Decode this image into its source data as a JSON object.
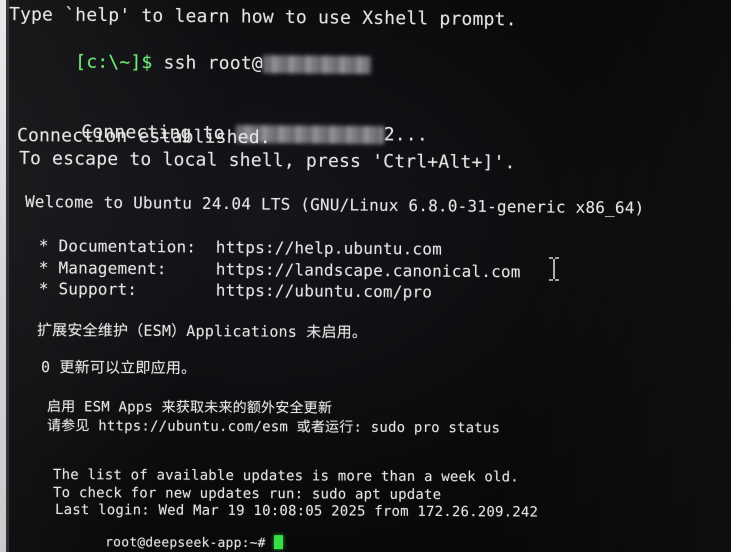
{
  "terminal": {
    "line1": "Type `help' to learn how to use Xshell prompt.",
    "prompt_local": "[c:\\~]$",
    "cmd_ssh": " ssh root@",
    "connecting_prefix": "Connecting to ",
    "connecting_suffix": "2...",
    "established": "Connection established.",
    "escape": "To escape to local shell, press 'Ctrl+Alt+]'.",
    "welcome": "Welcome to Ubuntu 24.04 LTS (GNU/Linux 6.8.0-31-generic x86_64)",
    "doc": " * Documentation:  https://help.ubuntu.com",
    "mgmt": " * Management:     https://landscape.canonical.com",
    "support": " * Support:        https://ubuntu.com/pro",
    "esm_status": "扩展安全维护（ESM）Applications 未启用。",
    "updates": "0 更新可以立即应用。",
    "esm_apps": "启用 ESM Apps 来获取未来的额外安全更新",
    "esm_see": "请参见 https://ubuntu.com/esm 或者运行: sudo pro status",
    "list_old": "The list of available updates is more than a week old.",
    "check_updates": "To check for new updates run: sudo apt update",
    "last_login": "Last login: Wed Mar 19 10:08:05 2025 from 172.26.209.242",
    "remote_prompt": "root@deepseek-app:~# "
  },
  "icons": {
    "cursor": "text-cursor-icon",
    "block_cursor": "block-cursor-icon"
  },
  "colors": {
    "background": "#0b0b0d",
    "text": "#e4e4e4",
    "prompt_green": "#5ef06a",
    "cursor_green": "#38e048"
  }
}
